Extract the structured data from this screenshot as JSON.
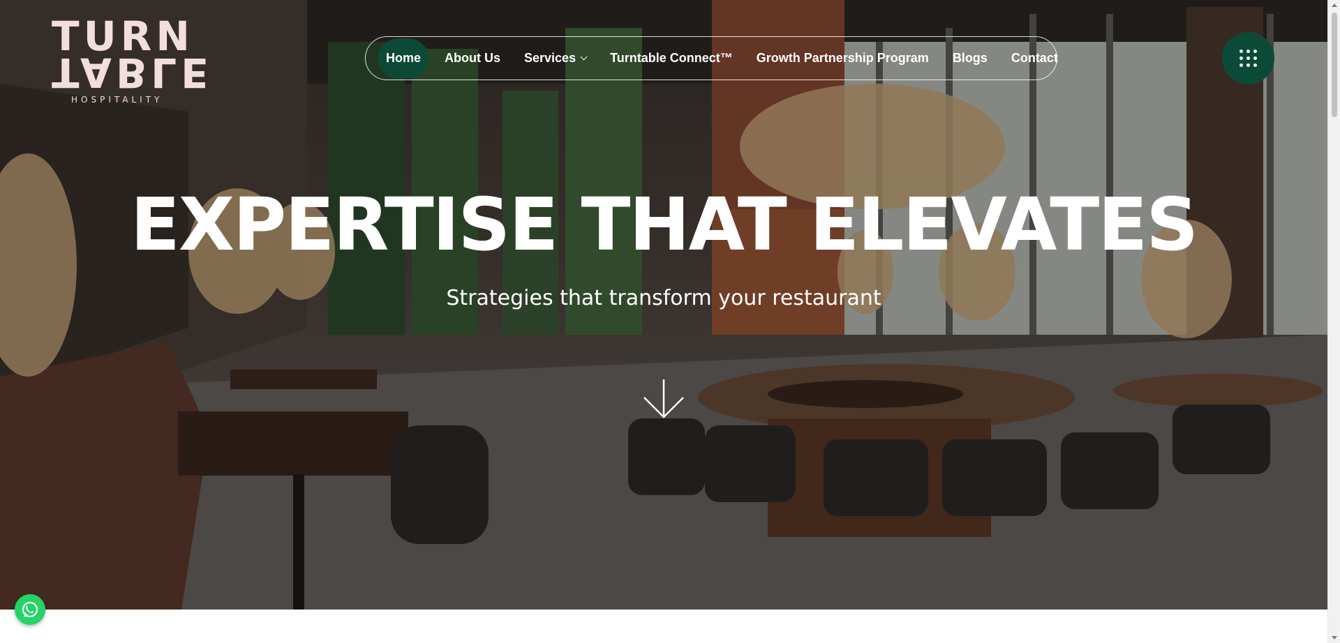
{
  "logo": {
    "line1": "TURN",
    "line2": "TABLE",
    "tagline": "HOSPITALITY"
  },
  "nav": {
    "items": [
      {
        "label": "Home",
        "active": true
      },
      {
        "label": "About Us"
      },
      {
        "label": "Services",
        "has_dropdown": true
      },
      {
        "label": "Turntable Connect™"
      },
      {
        "label": "Growth Partnership Program"
      },
      {
        "label": "Blogs"
      },
      {
        "label": "Contact"
      }
    ]
  },
  "hero": {
    "title": "EXPERTISE THAT ELEVATES",
    "subtitle": "Strategies that transform your restaurant"
  },
  "icons": {
    "menu": "grid-dots-icon",
    "scroll": "arrow-down-icon",
    "whatsapp": "whatsapp-icon"
  },
  "colors": {
    "brand_green": "#0c4a37",
    "logo_pink": "#f3dede",
    "whatsapp_green": "#25d366"
  }
}
